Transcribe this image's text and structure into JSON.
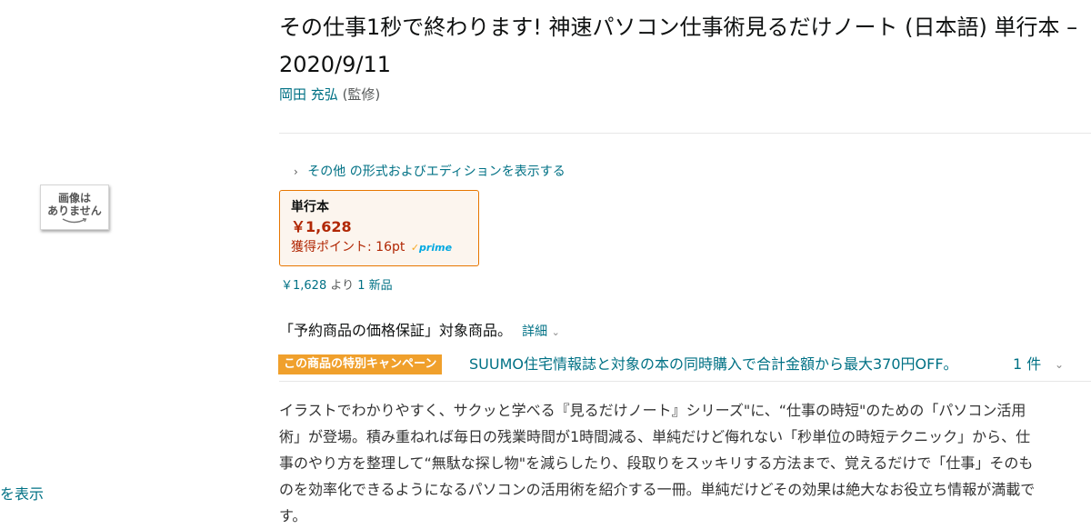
{
  "image_placeholder": {
    "line1": "画像は",
    "line2": "ありません"
  },
  "left_link": "を表示",
  "product": {
    "title": "その仕事1秒で終わります! 神速パソコン仕事術見るだけノート (日本語) 単行本 – 2020/9/11",
    "author_name": "岡田 充弘",
    "author_role": "(監修)"
  },
  "formats": {
    "other_formats_link": "その他 の形式およびエディションを表示する",
    "selected": {
      "format": "単行本",
      "price": "￥1,628",
      "points": "獲得ポイント: 16pt",
      "prime_label": "prime"
    },
    "new_offers": {
      "price": "￥1,628",
      "yori": "より",
      "count_link": "1 新品"
    }
  },
  "guarantee": {
    "text": "「予約商品の価格保証」対象商品。",
    "details_link": "詳細"
  },
  "campaign": {
    "badge": "この商品の特別キャンペーン",
    "text": "SUUMO住宅情報誌と対象の本の同時購入で合計金額から最大370円OFF。",
    "count": "1 件"
  },
  "description": "イラストでわかりやすく、サクッと学べる『見るだけノート』シリーズ\"に、“仕事の時短\"のための「パソコン活用術」が登場。積み重ねれば毎日の残業時間が1時間減る、単純だけど侮れない「秒単位の時短テクニック」から、仕事のやり方を整理して“無駄な探し物\"を減らしたり、段取りをスッキリする方法まで、覚えるだけで「仕事」そのものを効率化できるようになるパソコンの活用術を紹介する一冊。単純だけどその効果は絶大なお役立ち情報が満載です。",
  "colors": {
    "link": "#007185",
    "price": "#b12704",
    "badge": "#f0a02c",
    "box_border": "#e77600"
  }
}
